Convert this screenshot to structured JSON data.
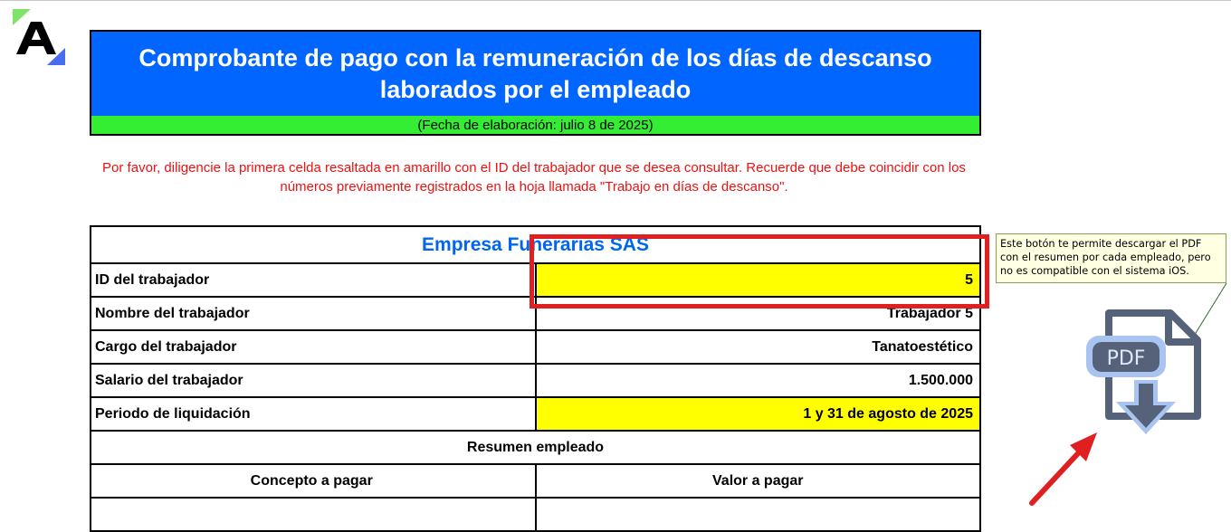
{
  "logo": {
    "letter": "A",
    "icon": "brand-a-logo"
  },
  "header": {
    "title": "Comprobante de pago con la remuneración de los días de descanso laborados por el empleado",
    "date": "(Fecha de elaboración: julio 8 de 2025)",
    "title_bg": "#0066ff",
    "date_bg": "#33ee33"
  },
  "instructions": "Por favor, diligencie la primera celda resaltada en amarillo con el ID del trabajador que se desea consultar. Recuerde que debe coincidir con los números previamente registrados en la hoja llamada \"Trabajo en días de descanso\".",
  "table": {
    "company": "Empresa Funerarias SAS",
    "rows": [
      {
        "label": "ID del trabajador",
        "value": "5"
      },
      {
        "label": "Nombre del trabajador",
        "value": "Trabajador 5"
      },
      {
        "label": "Cargo del trabajador",
        "value": "Tanatoestético"
      },
      {
        "label": "Salario del trabajador",
        "value": "1.500.000"
      },
      {
        "label": "Periodo de liquidación",
        "value": "1 y 31 de agosto de 2025"
      }
    ],
    "summary_header": "Resumen empleado",
    "columns": [
      "Concepto a pagar",
      "Valor a pagar"
    ]
  },
  "comment": "Este botón te permite descargar el PDF con el resumen por cada empleado, pero no es compatible con el sistema iOS.",
  "pdf_button": {
    "label": "PDF",
    "icon": "pdf-download-icon"
  },
  "colors": {
    "highlight_yellow": "#ffff00",
    "alert_red": "#e02020",
    "company_blue": "#0066ee"
  }
}
